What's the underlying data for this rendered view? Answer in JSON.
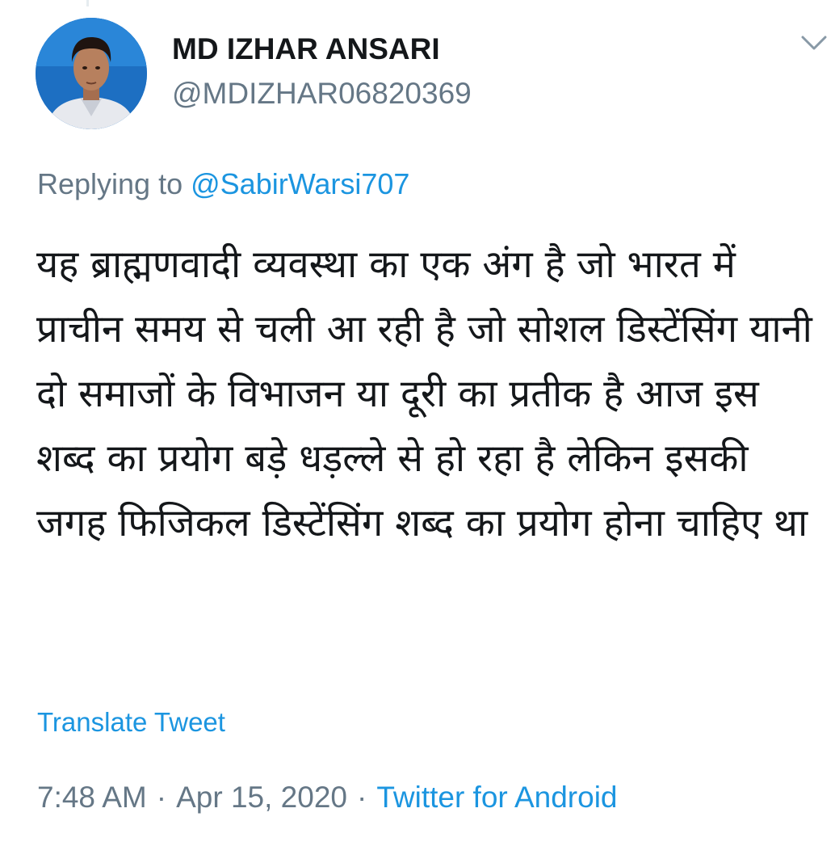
{
  "tweet": {
    "author": {
      "display_name": "MD IZHAR ANSARI",
      "handle": "@MDIZHAR06820369"
    },
    "reply": {
      "prefix": "Replying to",
      "mention": "@SabirWarsi707"
    },
    "text": "यह ब्राह्मणवादी व्यवस्था का एक अंग है जो भारत में प्राचीन समय से चली आ रही है जो सोशल डिस्टेंसिंग यानी दो समाजों के विभाजन या दूरी का प्रतीक है आज इस शब्द का प्रयोग बड़े धड़ल्ले से हो रहा है लेकिन इसकी जगह फिजिकल डिस्टेंसिंग शब्द का प्रयोग होना चाहिए था",
    "translate_label": "Translate Tweet",
    "meta": {
      "time": "7:48 AM",
      "separator": "·",
      "date": "Apr 15, 2020",
      "source": "Twitter for Android"
    }
  },
  "icons": {
    "menu": "chevron-down-icon",
    "avatar": "profile-photo"
  },
  "colors": {
    "link": "#1b95e0",
    "secondary_text": "#657786",
    "primary_text": "#14171a",
    "background": "#ffffff"
  }
}
